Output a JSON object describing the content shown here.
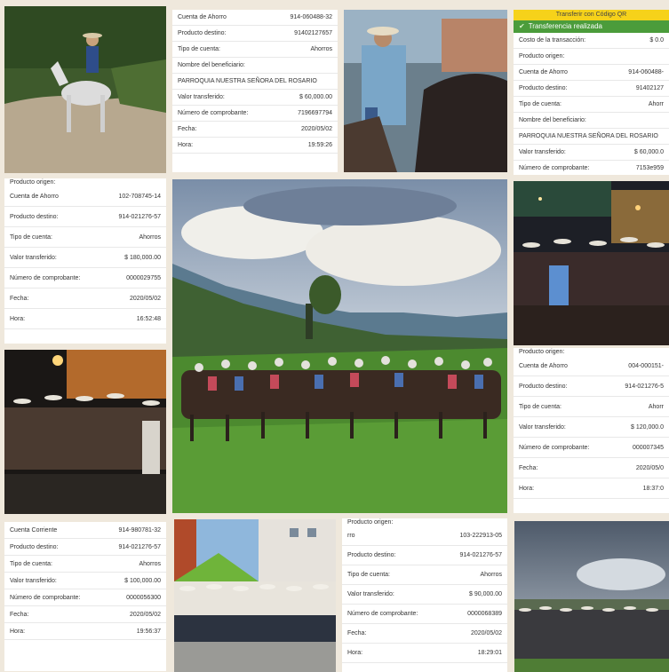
{
  "r1": {
    "rows": [
      {
        "label": "Cuenta de Ahorro",
        "value": "914-060488-32"
      },
      {
        "label": "Producto destino:",
        "value": "91402127657"
      },
      {
        "label": "Tipo de cuenta:",
        "value": "Ahorros"
      },
      {
        "label": "Nombre del beneficiario:",
        "value": ""
      },
      {
        "label": "PARROQUIA NUESTRA SEÑORA DEL ROSARIO",
        "value": ""
      },
      {
        "label": "Valor transferido:",
        "value": "$ 60,000.00"
      },
      {
        "label": "Número de comprobante:",
        "value": "7196697794"
      },
      {
        "label": "Fecha:",
        "value": "2020/05/02"
      },
      {
        "label": "Hora:",
        "value": "19:59:26"
      }
    ]
  },
  "r2": {
    "header": "Transferir con Código QR",
    "status": "Transferencia realizada",
    "rows": [
      {
        "label": "Costo de la transacción:",
        "value": "$ 0.0"
      },
      {
        "label": "Producto origen:",
        "value": ""
      },
      {
        "label": "Cuenta de Ahorro",
        "value": "914-060488-"
      },
      {
        "label": "Producto destino:",
        "value": "91402127"
      },
      {
        "label": "Tipo de cuenta:",
        "value": "Ahorr"
      },
      {
        "label": "Nombre del beneficiario:",
        "value": ""
      },
      {
        "label": "PARROQUIA NUESTRA SEÑORA DEL ROSARIO",
        "value": ""
      },
      {
        "label": "Valor transferido:",
        "value": "$ 60,000.0"
      },
      {
        "label": "Número de comprobante:",
        "value": "7153e959"
      }
    ]
  },
  "r3": {
    "top": "Producto origen:",
    "rows": [
      {
        "label": "Cuenta de Ahorro",
        "value": "102-708745-14"
      },
      {
        "label": "Producto destino:",
        "value": "914-021276-57"
      },
      {
        "label": "Tipo de cuenta:",
        "value": "Ahorros"
      },
      {
        "label": "Valor transferido:",
        "value": "$ 180,000.00"
      },
      {
        "label": "Número de comprobante:",
        "value": "0000029755"
      },
      {
        "label": "Fecha:",
        "value": "2020/05/02"
      },
      {
        "label": "Hora:",
        "value": "16:52:48"
      }
    ]
  },
  "r4": {
    "top": "Producto origen:",
    "rows": [
      {
        "label": "Cuenta de Ahorro",
        "value": "004-000151-"
      },
      {
        "label": "Producto destino:",
        "value": "914-021276-5"
      },
      {
        "label": "Tipo de cuenta:",
        "value": "Ahorr"
      },
      {
        "label": "Valor transferido:",
        "value": "$ 120,000.0"
      },
      {
        "label": "Número de comprobante:",
        "value": "000007345"
      },
      {
        "label": "Fecha:",
        "value": "2020/05/0"
      },
      {
        "label": "Hora:",
        "value": "18:37:0"
      }
    ]
  },
  "r5": {
    "rows": [
      {
        "label": "Cuenta Corriente",
        "value": "914-980781-32"
      },
      {
        "label": "Producto destino:",
        "value": "914-021276-57"
      },
      {
        "label": "Tipo de cuenta:",
        "value": "Ahorros"
      },
      {
        "label": "Valor transferido:",
        "value": "$ 100,000.00"
      },
      {
        "label": "Número de comprobante:",
        "value": "0000056300"
      },
      {
        "label": "Fecha:",
        "value": "2020/05/02"
      },
      {
        "label": "Hora:",
        "value": "19:56:37"
      }
    ]
  },
  "r6": {
    "top": "Producto origen:",
    "rows": [
      {
        "label": "rro",
        "value": "103-222913-05"
      },
      {
        "label": "Producto destino:",
        "value": "914-021276-57"
      },
      {
        "label": "Tipo de cuenta:",
        "value": "Ahorros"
      },
      {
        "label": "Valor transferido:",
        "value": "$ 90,000.00"
      },
      {
        "label": "Número de comprobante:",
        "value": "0000068389"
      },
      {
        "label": "Fecha:",
        "value": "2020/05/02"
      },
      {
        "label": "Hora:",
        "value": "18:29:01"
      }
    ]
  },
  "colors": {
    "qr_header": "#f6d21a",
    "qr_success": "#4b9c3b",
    "background": "#efe8dc"
  }
}
